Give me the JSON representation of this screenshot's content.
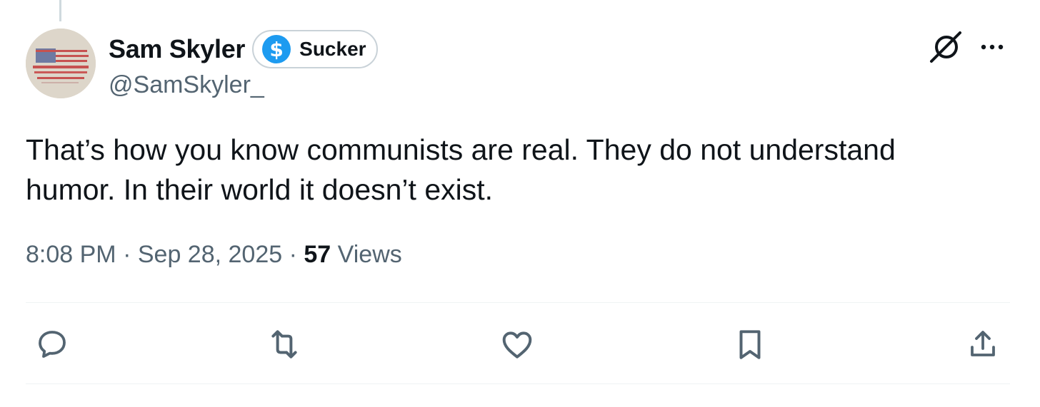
{
  "tweet": {
    "author": {
      "display_name": "Sam Skyler",
      "handle": "@SamSkyler_",
      "badge_label": "Sucker",
      "badge_icon": "dollar-icon",
      "avatar": "flag-avatar"
    },
    "text_line1": "That’s how you know communists are real. They do not understand",
    "text_line2": "humor. In their world it doesn’t exist.",
    "time": "8:08 PM",
    "date": "Sep 28, 2025",
    "views_count": "57",
    "views_label": "Views",
    "separator": "·"
  },
  "actions": [
    "reply-icon",
    "retweet-icon",
    "like-icon",
    "bookmark-icon",
    "share-icon"
  ],
  "colors": {
    "text": "#0f1419",
    "secondary": "#536471",
    "accent": "#1d9bf0",
    "divider": "#eff3f4"
  }
}
